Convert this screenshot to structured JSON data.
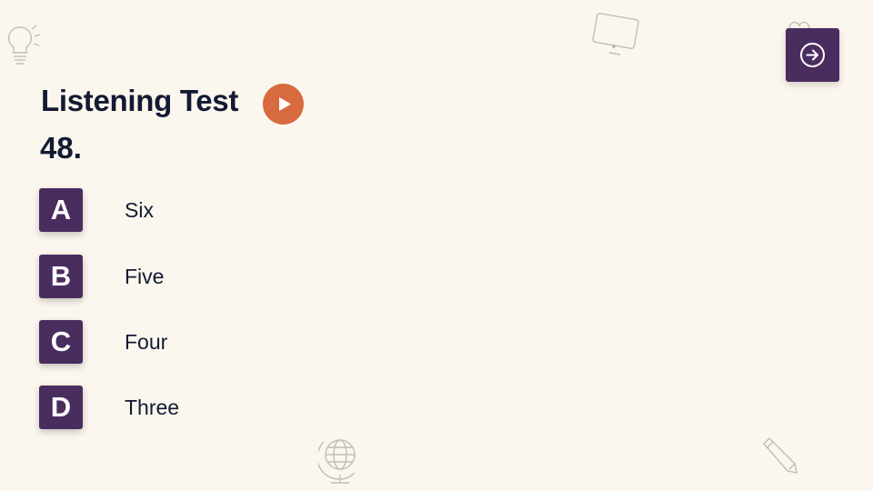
{
  "quiz": {
    "title": "Listening Test",
    "question_number": "48.",
    "options": [
      {
        "letter": "A",
        "text": "Six"
      },
      {
        "letter": "B",
        "text": "Five"
      },
      {
        "letter": "C",
        "text": "Four"
      },
      {
        "letter": "D",
        "text": "Three"
      }
    ]
  },
  "icons": {
    "play": "play-icon",
    "next": "arrow-right-circle-icon",
    "decorations": [
      "lightbulb-icon",
      "monitor-icon",
      "gift-icon",
      "globe-icon",
      "pencil-icon"
    ]
  },
  "colors": {
    "background": "#fbf7ee",
    "accent_purple": "#4a2d5f",
    "play_orange": "#d86a3f",
    "text_dark": "#131a33"
  }
}
